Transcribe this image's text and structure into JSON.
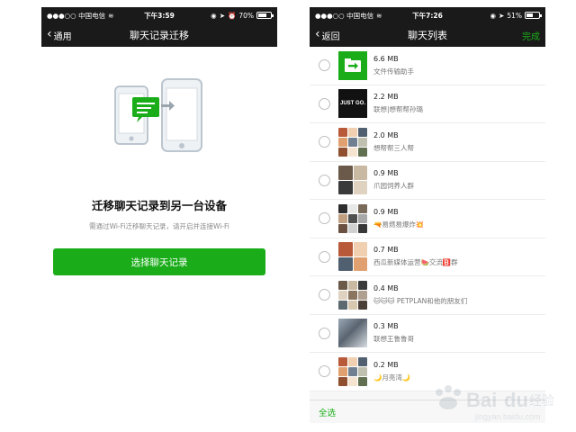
{
  "left": {
    "status": {
      "carrier": "●●●○○ 中国电信",
      "time": "下午3:59",
      "battery": "70%",
      "battery_level": 0.7
    },
    "nav": {
      "back": "通用",
      "title": "聊天记录迁移"
    },
    "headline": "迁移聊天记录到另一台设备",
    "subtext": "需通过Wi-Fi迁移聊天记录，请开启并连接Wi-Fi",
    "button": "选择聊天记录"
  },
  "right": {
    "status": {
      "carrier": "●●●○○ 中国电信",
      "time": "下午7:26",
      "battery": "51%",
      "battery_level": 0.51
    },
    "nav": {
      "back": "返回",
      "title": "聊天列表",
      "done": "完成"
    },
    "chats": [
      {
        "size": "6.6 MB",
        "name": "文件传输助手",
        "avatar": "file-transfer"
      },
      {
        "size": "2.2 MB",
        "name": "联想|想帮帮孙璐",
        "avatar": "justgo",
        "avatar_text": "JUST GO."
      },
      {
        "size": "2.0 MB",
        "name": "想帮帮三人帮",
        "avatar": "group"
      },
      {
        "size": "0.9 MB",
        "name": "爪园饲养人群",
        "avatar": "group"
      },
      {
        "size": "0.9 MB",
        "name": "🔫易燃易爆炸💥",
        "avatar": "group"
      },
      {
        "size": "0.7 MB",
        "name": "西瓜新媒体运营🍉交流🅱️群",
        "avatar": "group"
      },
      {
        "size": "0.4 MB",
        "name": "🐱🐱🐱 PETPLAN和他的朋友们",
        "avatar": "group"
      },
      {
        "size": "0.3 MB",
        "name": "联想王鲁鲁哥",
        "avatar": "photo"
      },
      {
        "size": "0.2 MB",
        "name": "🌙月亮湾🌙",
        "avatar": "group"
      }
    ],
    "select_all": "全选"
  },
  "watermark": {
    "text": "Baidu经验",
    "url": "jingyan.baidu.com"
  },
  "colors": {
    "bar": "#1a1a1a",
    "accent": "#1aad19",
    "text": "#111111",
    "muted": "#888888"
  }
}
